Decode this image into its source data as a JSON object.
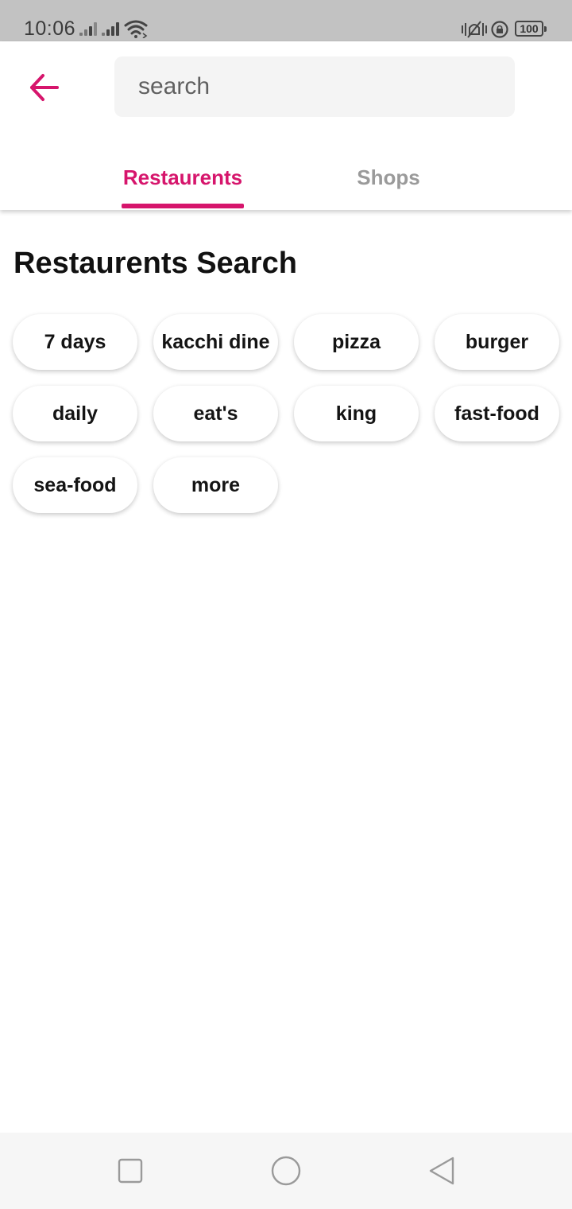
{
  "status_bar": {
    "time": "10:06",
    "battery": "100",
    "icons": [
      "signal-icon",
      "signal-icon",
      "wifi-icon",
      "vibrate-icon",
      "rotation-lock-icon",
      "battery-icon"
    ]
  },
  "header": {
    "back_icon": "arrow-left-icon",
    "search": {
      "placeholder": "search",
      "value": ""
    },
    "tabs": [
      {
        "label": "Restaurents",
        "active": true
      },
      {
        "label": "Shops",
        "active": false
      }
    ]
  },
  "section": {
    "title": "Restaurents Search",
    "chips": [
      "7 days",
      "kacchi dine",
      "pizza",
      "burger",
      "daily",
      "eat's",
      "king",
      "fast-food",
      "sea-food",
      "more"
    ]
  },
  "nav_bar": {
    "buttons": [
      "recents-square-icon",
      "home-circle-icon",
      "back-triangle-icon"
    ]
  },
  "colors": {
    "accent": "#d6156c",
    "inactive_tab": "#9a9a9a",
    "status_bar_bg": "#c2c2c2",
    "search_bg": "#f4f4f4"
  }
}
